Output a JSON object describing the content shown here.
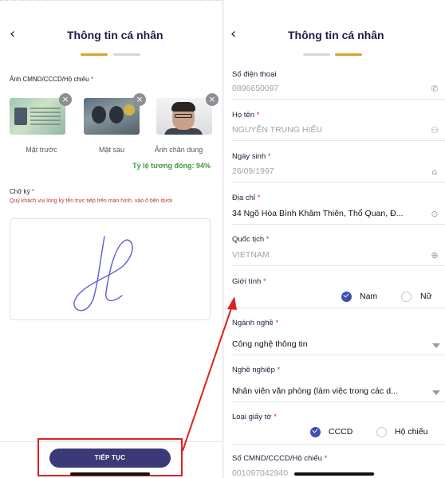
{
  "left": {
    "header": {
      "back": "‹",
      "title": "Thông tin cá nhân"
    },
    "id_section": {
      "label": "Ảnh CMND/CCCD/Hộ chiếu",
      "required": "*"
    },
    "cards": [
      {
        "caption": "Mặt trước"
      },
      {
        "caption": "Mặt sau"
      },
      {
        "caption": "Ảnh chân dung"
      }
    ],
    "close_glyph": "×",
    "similarity": "Tỷ lệ tương đồng: 94%",
    "signature": {
      "label": "Chữ ký",
      "required": "*",
      "hint": "Quý khách vui lòng ký tên trực tiếp trên màn hình, vào ô bên dưới",
      "stroke_color": "#5b5bd6"
    },
    "next_button": "TIẾP TỤC"
  },
  "right": {
    "header": {
      "back": "‹",
      "title": "Thông tin cá nhân"
    },
    "fields": {
      "phone": {
        "label": "Số điện thoại",
        "value": "0896650097",
        "icon": "phone-icon"
      },
      "name": {
        "label": "Họ tên",
        "required": "*",
        "value": "NGUYỄN TRUNG HIẾU",
        "icon": "person-icon"
      },
      "dob": {
        "label": "Ngày sinh",
        "required": "*",
        "value": "26/09/1997",
        "icon": "cake-icon"
      },
      "address": {
        "label": "Địa chỉ",
        "required": "*",
        "value": "34 Ngõ Hòa Bình Khâm Thiên, Thổ Quan, Đ...",
        "icon": "location-pin-icon"
      },
      "nationality": {
        "label": "Quốc tịch",
        "required": "*",
        "value": "VIETNAM",
        "icon": "globe-icon"
      },
      "gender": {
        "label": "Giới tính",
        "required": "*",
        "options": [
          "Nam",
          "Nữ"
        ],
        "selected": "Nam"
      },
      "industry": {
        "label": "Ngành nghề",
        "required": "*",
        "value": "Công nghệ thông tin"
      },
      "occupation": {
        "label": "Nghề nghiệp",
        "required": "*",
        "value": "Nhân viên văn phòng (làm việc trong các d..."
      },
      "doc_type": {
        "label": "Loại giấy tờ",
        "required": "*",
        "options": [
          "CCCD",
          "Hộ chiếu"
        ],
        "selected": "CCCD"
      },
      "id_number": {
        "label": "Số CMND/CCCD/Hộ chiếu",
        "required": "*",
        "value": "001097042940"
      }
    }
  },
  "colors": {
    "accent": "#3b3a78",
    "step_active": "#d4a52a",
    "required": "#d0312d",
    "success": "#3f9b3c",
    "annotation": "#e02020"
  }
}
